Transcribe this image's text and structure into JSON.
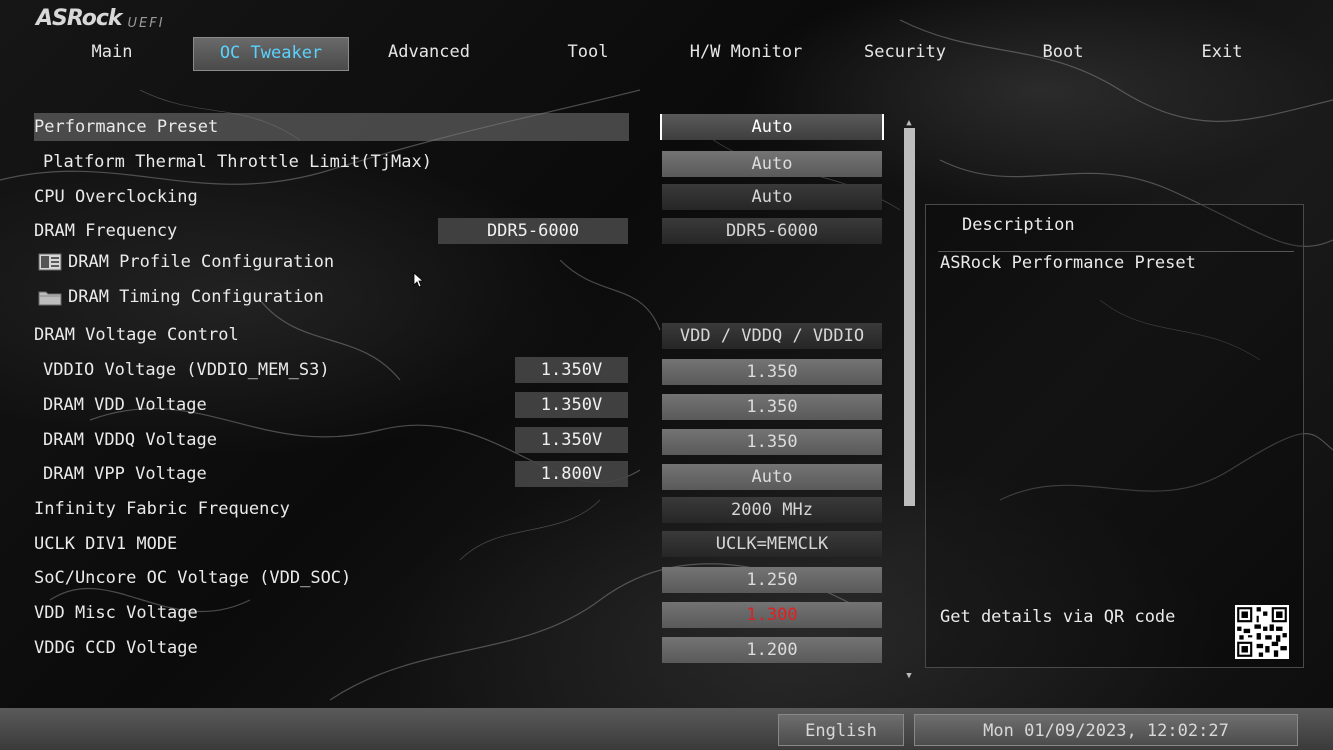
{
  "app": {
    "brand": "ASRock",
    "brand_sub": "UEFI"
  },
  "tabs": [
    {
      "label": "Main"
    },
    {
      "label": "OC Tweaker",
      "active": true
    },
    {
      "label": "Advanced"
    },
    {
      "label": "Tool"
    },
    {
      "label": "H/W Monitor"
    },
    {
      "label": "Security"
    },
    {
      "label": "Boot"
    },
    {
      "label": "Exit"
    }
  ],
  "settings": [
    {
      "label": "Performance Preset",
      "option": "Auto"
    },
    {
      "label": "Platform Thermal Throttle Limit(TjMax)",
      "option": "Auto"
    },
    {
      "label": "CPU Overclocking",
      "option": "Auto"
    },
    {
      "label": "DRAM Frequency",
      "current": "DDR5-6000",
      "option": "DDR5-6000"
    },
    {
      "label": "DRAM Profile Configuration",
      "icon": "profile-icon"
    },
    {
      "label": "DRAM Timing Configuration",
      "icon": "folder-icon"
    },
    {
      "label": "DRAM Voltage Control",
      "option": "VDD / VDDQ / VDDIO"
    },
    {
      "label": "VDDIO Voltage (VDDIO_MEM_S3)",
      "current": "1.350V",
      "option": "1.350"
    },
    {
      "label": "DRAM VDD Voltage",
      "current": "1.350V",
      "option": "1.350"
    },
    {
      "label": "DRAM VDDQ Voltage",
      "current": "1.350V",
      "option": "1.350"
    },
    {
      "label": "DRAM VPP Voltage",
      "current": "1.800V",
      "option": "Auto"
    },
    {
      "label": "Infinity Fabric Frequency",
      "option": "2000 MHz"
    },
    {
      "label": "UCLK DIV1 MODE",
      "option": "UCLK=MEMCLK"
    },
    {
      "label": "SoC/Uncore OC Voltage (VDD_SOC)",
      "option": "1.250"
    },
    {
      "label": "VDD Misc Voltage",
      "option": "1.300"
    },
    {
      "label": "VDDG CCD Voltage",
      "option": "1.200"
    }
  ],
  "description": {
    "title": "Description",
    "text": "ASRock Performance Preset",
    "qr_text": "Get details via QR code"
  },
  "footer": {
    "language": "English",
    "datetime": "Mon 01/09/2023, 12:02:27"
  },
  "colors": {
    "active_tab_text": "#5ad2ff",
    "warning_value": "#e02020"
  }
}
